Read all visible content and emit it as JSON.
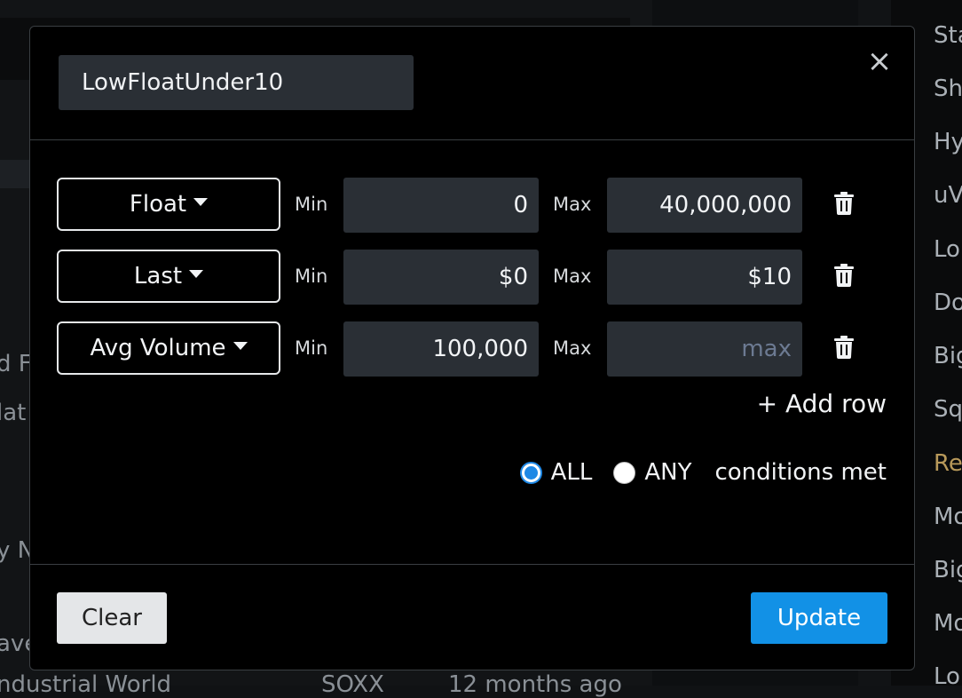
{
  "background": {
    "fragments": [
      "d F",
      "lat",
      "y N",
      "ave",
      "ndustrial World",
      "SOXX",
      "12 months ago"
    ],
    "right_list": [
      "Sta",
      "Sh",
      "Hy",
      "uV",
      "Lo",
      "Do",
      "Big",
      "Sq",
      "Re",
      "Mo",
      "Big",
      "Mo",
      "Lo"
    ]
  },
  "dialog": {
    "name_value": "LowFloatUnder10",
    "close_icon": "close-icon",
    "rows": [
      {
        "field": "Float",
        "min_label": "Min",
        "min_value": "0",
        "max_label": "Max",
        "max_value": "40,000,000"
      },
      {
        "field": "Last",
        "min_label": "Min",
        "min_value": "$0",
        "max_label": "Max",
        "max_value": "$10"
      },
      {
        "field": "Avg Volume",
        "min_label": "Min",
        "min_value": "100,000",
        "max_label": "Max",
        "max_value": "",
        "max_placeholder": "max"
      }
    ],
    "add_row_label": "+ Add row",
    "condition": {
      "all_label": "ALL",
      "any_label": "ANY",
      "selected": "ALL",
      "suffix": "conditions met"
    },
    "clear_label": "Clear",
    "update_label": "Update"
  },
  "colors": {
    "accent": "#1291e6",
    "modal_bg": "#000000",
    "input_bg": "#2a2f35"
  }
}
